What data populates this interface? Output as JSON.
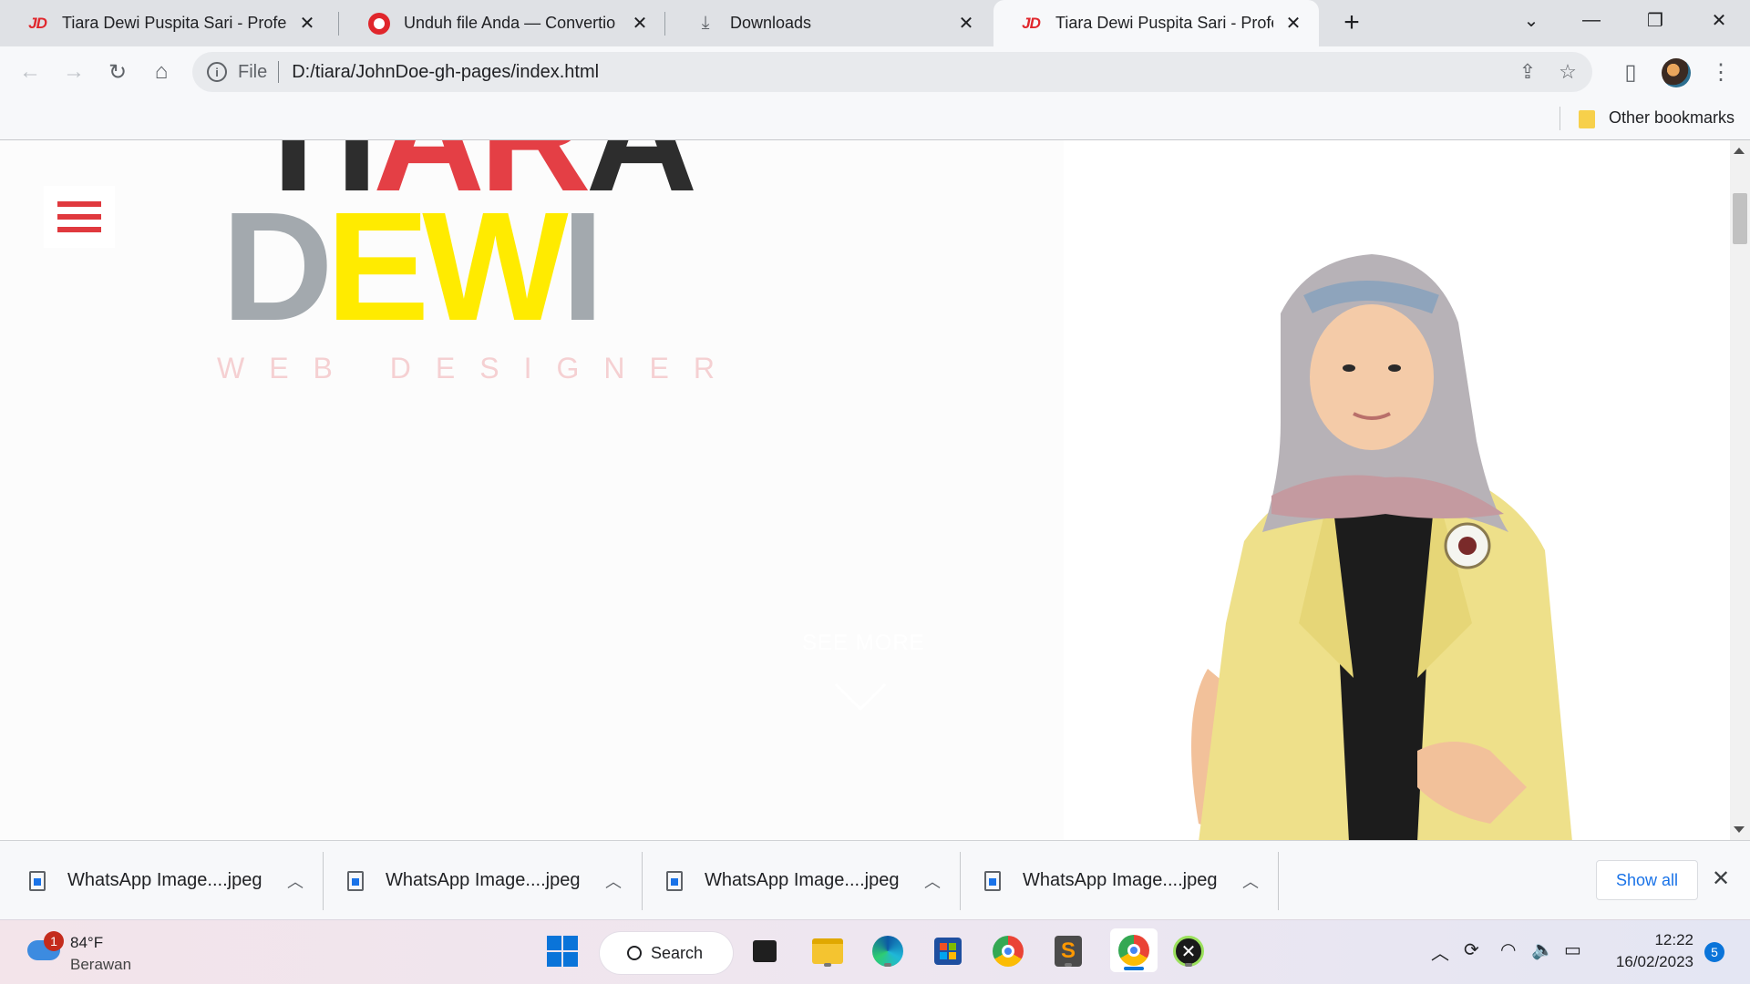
{
  "browser": {
    "tabs": [
      {
        "title": "Tiara Dewi Puspita Sari - Professi",
        "favicon": "JD",
        "active": false
      },
      {
        "title": "Unduh file Anda — Convertio",
        "favicon": "convertio-icon",
        "active": false
      },
      {
        "title": "Downloads",
        "favicon": "download-icon",
        "active": false
      },
      {
        "title": "Tiara Dewi Puspita Sari - Professi",
        "favicon": "JD",
        "active": true
      }
    ],
    "address": {
      "scheme": "File",
      "url": "D:/tiara/JohnDoe-gh-pages/index.html"
    },
    "bookmarks": {
      "other_label": "Other bookmarks"
    }
  },
  "page": {
    "name_first_dark": "TI",
    "name_first_red": "AR",
    "name_first_dark2": "A",
    "name_last_gray": "D",
    "name_last_yellow": "EW",
    "name_last_gray2": "I",
    "tagline": "WEB DESIGNER",
    "see_more": "SEE MORE",
    "colors": {
      "red": "#e43f45",
      "yellow": "#ffeb00",
      "gray": "#a3a9ae",
      "dark": "#2d2d2d"
    }
  },
  "downloads": {
    "items": [
      {
        "name": "WhatsApp Image....jpeg"
      },
      {
        "name": "WhatsApp Image....jpeg"
      },
      {
        "name": "WhatsApp Image....jpeg"
      },
      {
        "name": "WhatsApp Image....jpeg"
      }
    ],
    "show_all": "Show all"
  },
  "taskbar": {
    "weather": {
      "badge": "1",
      "temp": "84°F",
      "condition": "Berawan"
    },
    "search_label": "Search",
    "clock": {
      "time": "12:22",
      "date": "16/02/2023"
    },
    "notifications": "5"
  }
}
